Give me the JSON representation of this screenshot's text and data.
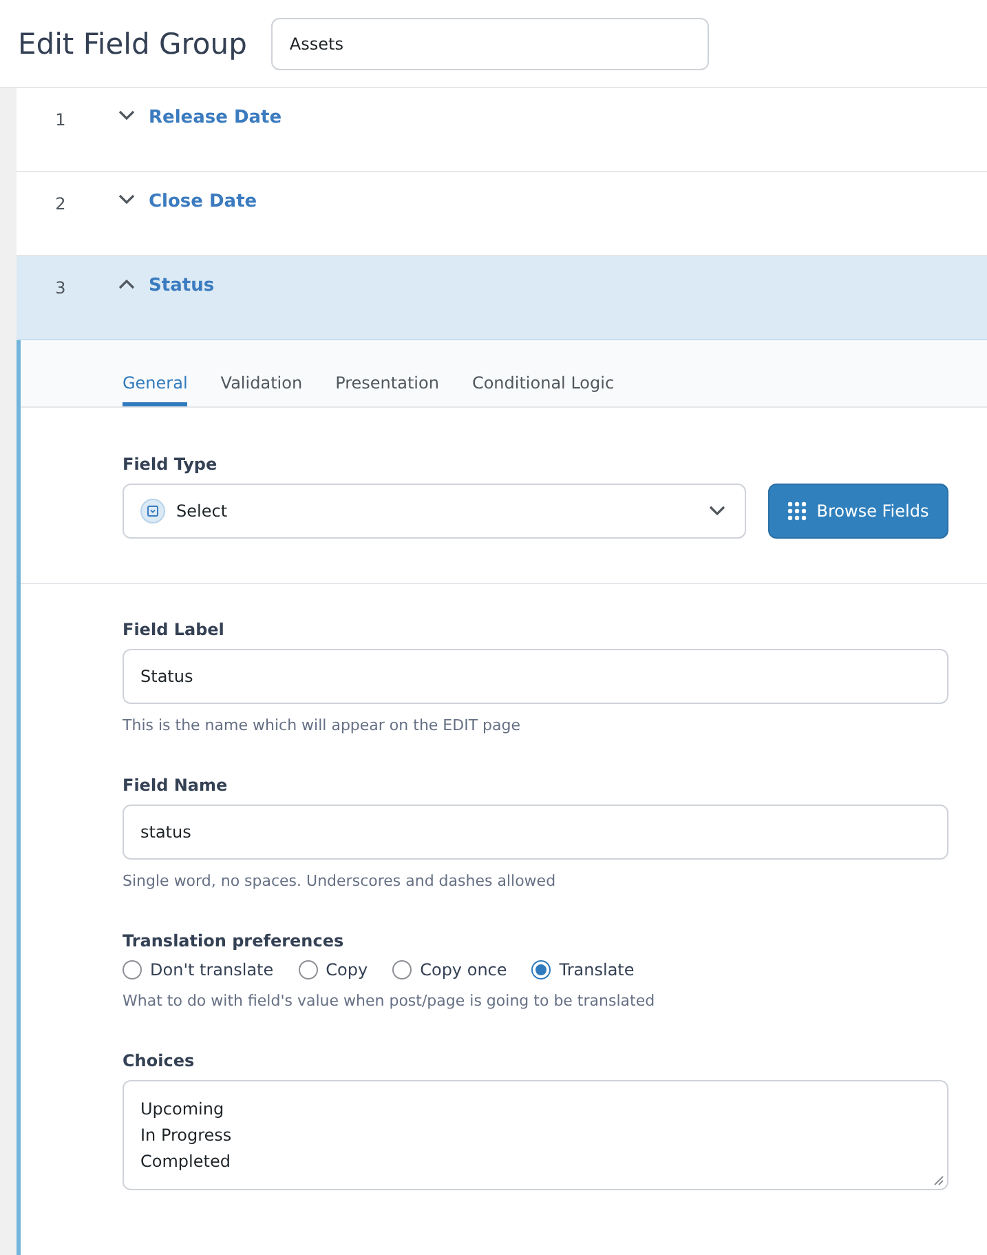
{
  "header": {
    "title": "Edit Field Group",
    "group_name": "Assets"
  },
  "fields": [
    {
      "number": "1",
      "label": "Release Date",
      "expanded": false
    },
    {
      "number": "2",
      "label": "Close Date",
      "expanded": false
    },
    {
      "number": "3",
      "label": "Status",
      "expanded": true
    }
  ],
  "settings": {
    "tabs": [
      {
        "label": "General",
        "selected": true
      },
      {
        "label": "Validation",
        "selected": false
      },
      {
        "label": "Presentation",
        "selected": false
      },
      {
        "label": "Conditional Logic",
        "selected": false
      }
    ],
    "field_type": {
      "label": "Field Type",
      "value": "Select",
      "browse_button": "Browse Fields"
    },
    "field_label": {
      "label": "Field Label",
      "value": "Status",
      "help": "This is the name which will appear on the EDIT page"
    },
    "field_name": {
      "label": "Field Name",
      "value": "status",
      "help": "Single word, no spaces. Underscores and dashes allowed"
    },
    "translation": {
      "label": "Translation preferences",
      "options": [
        {
          "label": "Don't translate",
          "selected": false
        },
        {
          "label": "Copy",
          "selected": false
        },
        {
          "label": "Copy once",
          "selected": false
        },
        {
          "label": "Translate",
          "selected": true
        }
      ],
      "help": "What to do with field's value when post/page is going to be translated"
    },
    "choices": {
      "label": "Choices",
      "value": "Upcoming\nIn Progress\nCompleted"
    }
  }
}
